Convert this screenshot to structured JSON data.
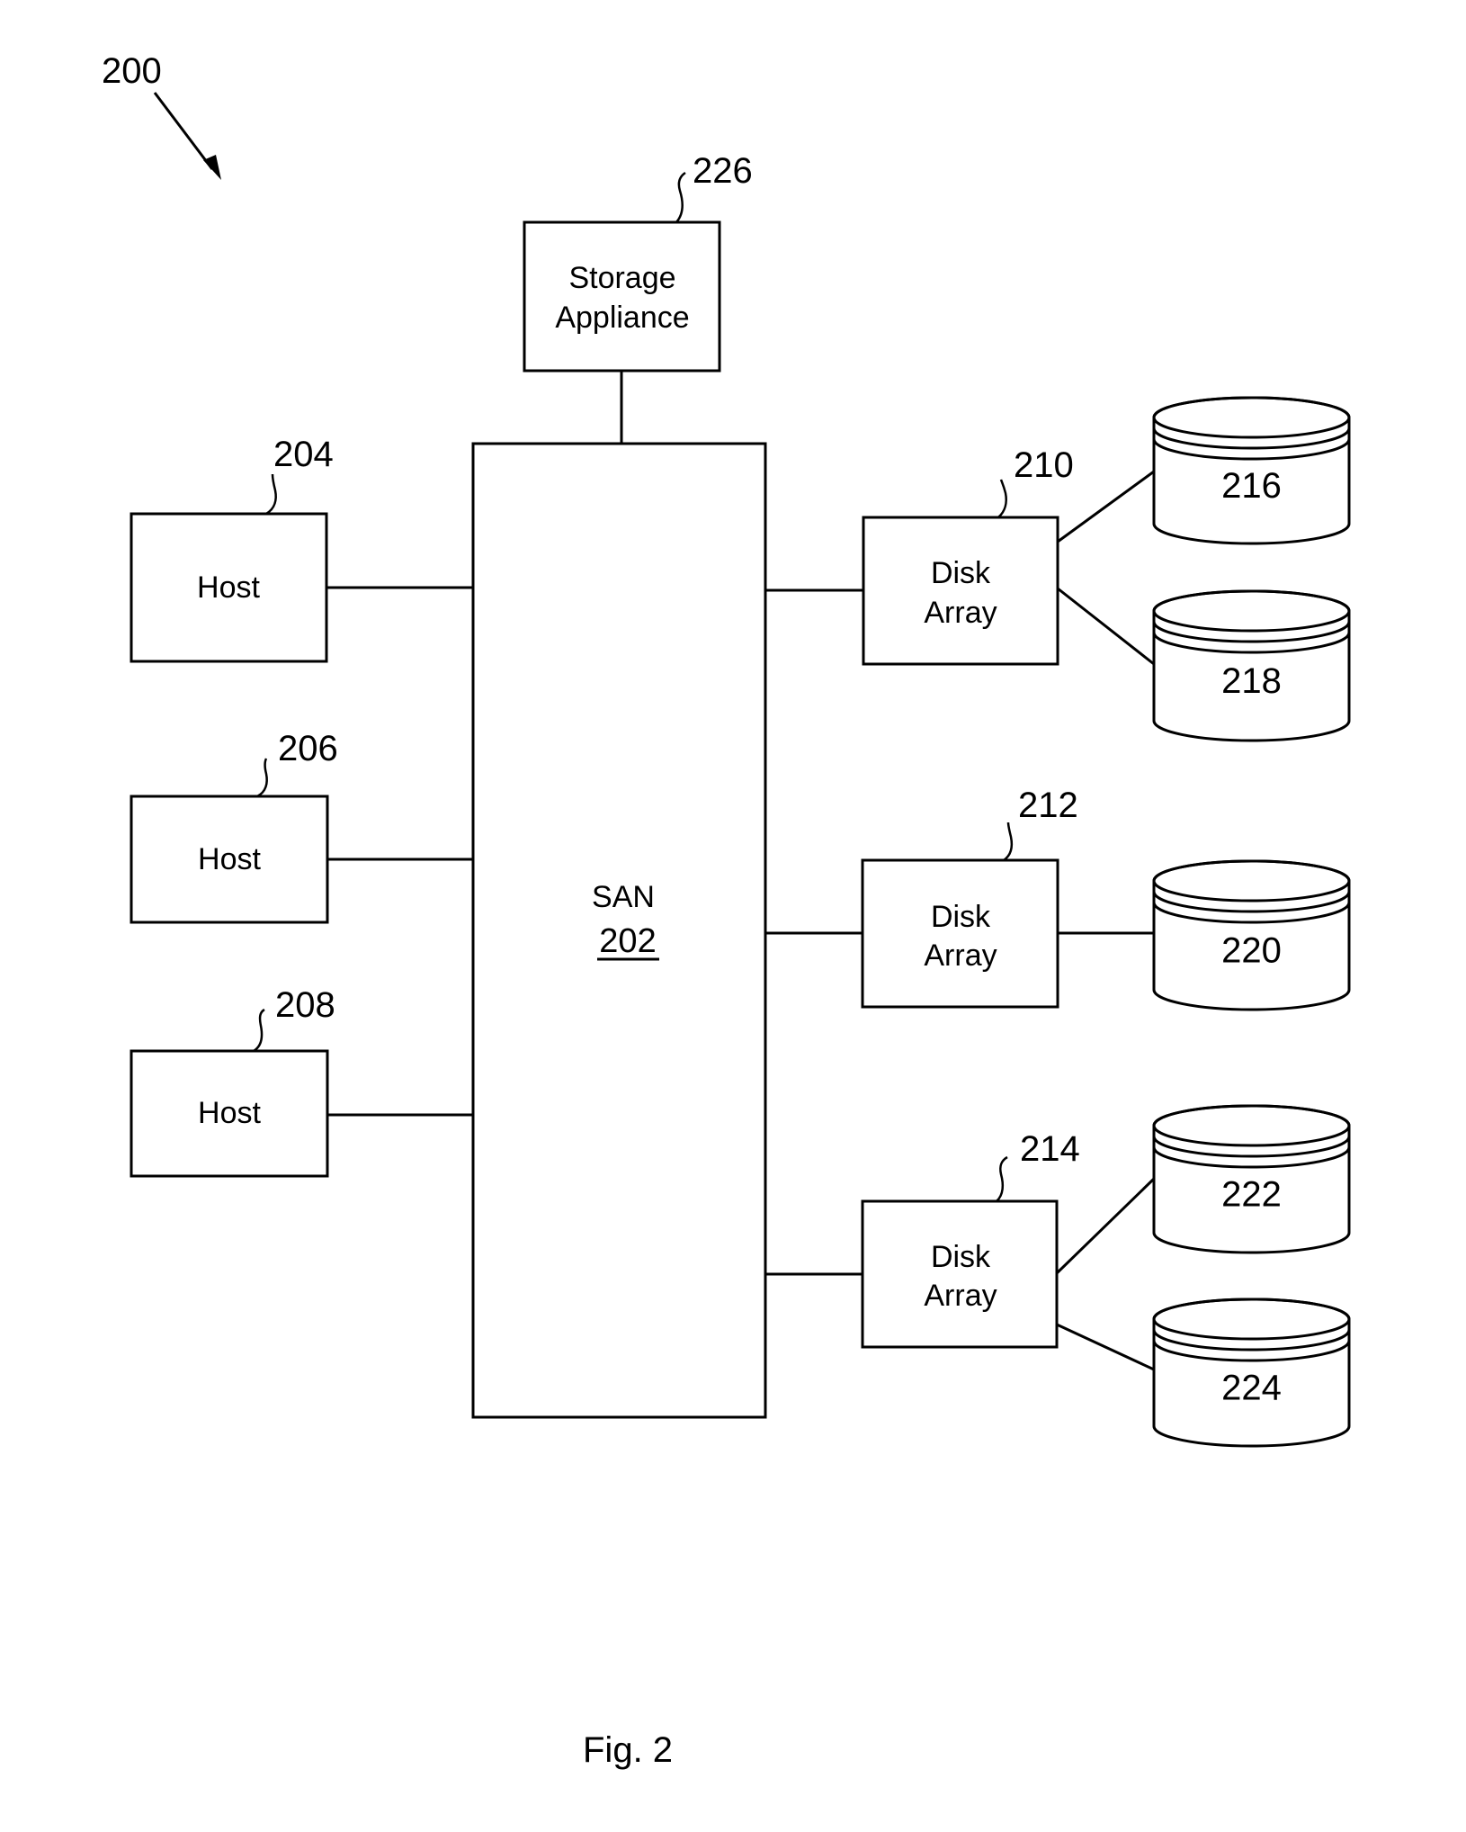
{
  "figure": {
    "number_label": "200",
    "caption": "Fig. 2"
  },
  "san": {
    "label": "SAN",
    "ref": "202"
  },
  "storage_appliance": {
    "line1": "Storage",
    "line2": "Appliance",
    "ref": "226"
  },
  "hosts": [
    {
      "label": "Host",
      "ref": "204"
    },
    {
      "label": "Host",
      "ref": "206"
    },
    {
      "label": "Host",
      "ref": "208"
    }
  ],
  "disk_arrays": [
    {
      "line1": "Disk",
      "line2": "Array",
      "ref": "210",
      "disks": [
        "216",
        "218"
      ]
    },
    {
      "line1": "Disk",
      "line2": "Array",
      "ref": "212",
      "disks": [
        "220"
      ]
    },
    {
      "line1": "Disk",
      "line2": "Array",
      "ref": "214",
      "disks": [
        "222",
        "224"
      ]
    }
  ],
  "disks": {
    "d216": "216",
    "d218": "218",
    "d220": "220",
    "d222": "222",
    "d224": "224"
  }
}
